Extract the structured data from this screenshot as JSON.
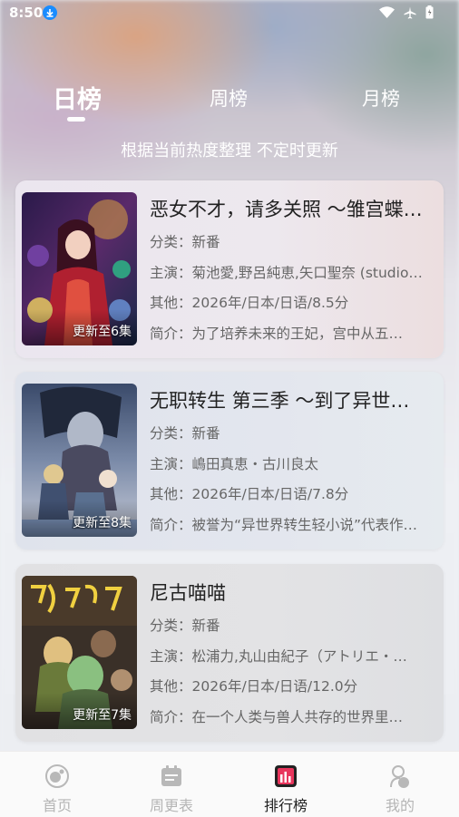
{
  "status_bar": {
    "time": "8:50"
  },
  "tabs": [
    {
      "label": "日榜",
      "active": true
    },
    {
      "label": "周榜",
      "active": false
    },
    {
      "label": "月榜",
      "active": false
    }
  ],
  "subtitle": "根据当前热度整理 不定时更新",
  "items": [
    {
      "title": "恶女不才，请多关照 ～雏宫蝶…",
      "category": "分类：新番",
      "cast": "主演：菊池愛,野呂純恵,矢口聖奈 (studio…",
      "other": "其他：2026年/日本/日语/8.5分",
      "intro": "简介：为了培养未来的王妃，宫中从五…",
      "badge": "更新至6集"
    },
    {
      "title": "无职转生 第三季 ～到了异世…",
      "category": "分类：新番",
      "cast": "主演：嶋田真恵・古川良太",
      "other": "其他：2026年/日本/日语/7.8分",
      "intro": "简介：被誉为“异世界转生轻小说”代表作…",
      "badge": "更新至8集"
    },
    {
      "title": "尼古喵喵",
      "category": "分类：新番",
      "cast": "主演：松浦力,丸山由紀子（アトリエ・…",
      "other": "其他：2026年/日本/日语/12.0分",
      "intro": "简介：在一个人类与兽人共存的世界里…",
      "badge": "更新至7集"
    }
  ],
  "nav": [
    {
      "label": "首页",
      "icon": "home-icon",
      "active": false
    },
    {
      "label": "周更表",
      "icon": "calendar-icon",
      "active": false
    },
    {
      "label": "排行榜",
      "icon": "ranking-icon",
      "active": true
    },
    {
      "label": "我的",
      "icon": "profile-icon",
      "active": false
    }
  ],
  "colors": {
    "accent": "#e8365d",
    "status_download": "#1a8cff"
  }
}
